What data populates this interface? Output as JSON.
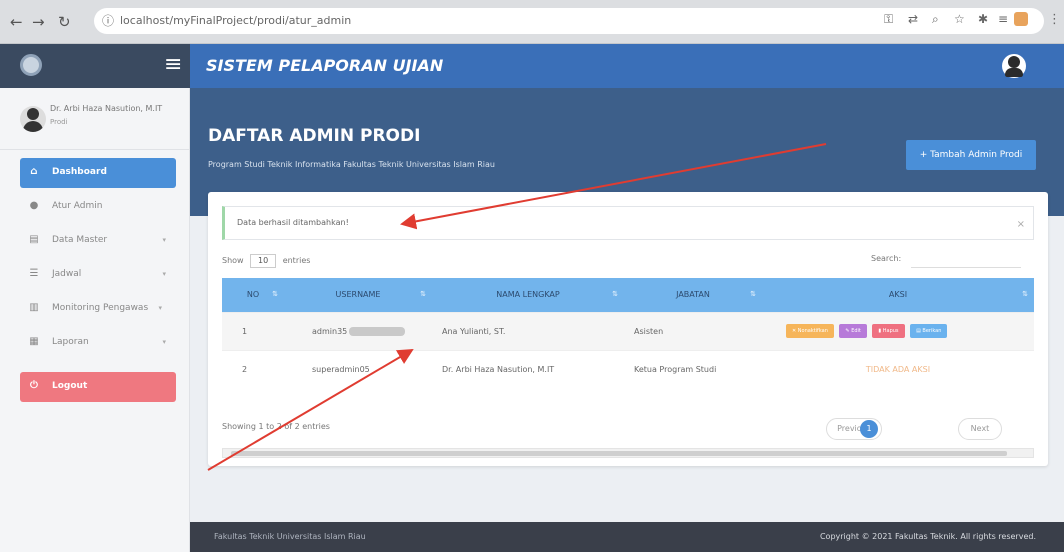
{
  "browser": {
    "url": "localhost/myFinalProject/prodi/atur_admin",
    "info_icon": "info-icon",
    "colors": {
      "chrome": "#dcdee1"
    }
  },
  "header": {
    "system_title": "SISTEM PELAPORAN UJIAN",
    "accent_color": "#3a6fb8"
  },
  "sidebar": {
    "user": {
      "name": "Dr. Arbi Haza Nasution, M.IT",
      "role": "Prodi"
    },
    "items": [
      {
        "label": "Dashboard",
        "icon": "home-icon",
        "active": true
      },
      {
        "label": "Atur Admin",
        "icon": "user-icon"
      },
      {
        "label": "Data Master",
        "icon": "database-icon",
        "caret": "▾"
      },
      {
        "label": "Jadwal",
        "icon": "list-icon",
        "caret": "▾"
      },
      {
        "label": "Monitoring Pengawas",
        "icon": "monitor-icon",
        "caret": "▾"
      },
      {
        "label": "Laporan",
        "icon": "report-icon",
        "caret": "▾"
      }
    ],
    "logout": {
      "label": "Logout",
      "icon": "power-icon"
    }
  },
  "page": {
    "title": "DAFTAR ADMIN PRODI",
    "subtitle": "Program Studi Teknik Informatika Fakultas Teknik Universitas Islam Riau",
    "add_button": "+ Tambah Admin Prodi"
  },
  "alert": {
    "text": "Data berhasil ditambahkan!",
    "close": "×"
  },
  "table": {
    "show_prefix": "Show",
    "entries_value": "10",
    "show_suffix": "entries",
    "search_label": "Search:",
    "columns": [
      "NO",
      "USERNAME",
      "NAMA LENGKAP",
      "JABATAN",
      "AKSI"
    ],
    "rows": [
      {
        "no": "1",
        "username": "admin35",
        "nama": "Ana Yulianti, ST.",
        "jabatan": "Asisten",
        "actions": [
          "Nonaktifkan",
          "Edit",
          "Hapus",
          "Berikan"
        ]
      },
      {
        "no": "2",
        "username": "superadmin05",
        "nama": "Dr. Arbi Haza Nasution, M.IT",
        "jabatan": "Ketua Program Studi",
        "no_action": "TIDAK ADA AKSI"
      }
    ],
    "showing": "Showing 1 to 2 of 2 entries",
    "pagination": {
      "previous": "Previous",
      "current": "1",
      "next": "Next"
    }
  },
  "footer": {
    "left": "Fakultas Teknik Universitas Islam Riau",
    "right": "Copyright © 2021 Fakultas Teknik. All rights reserved."
  }
}
